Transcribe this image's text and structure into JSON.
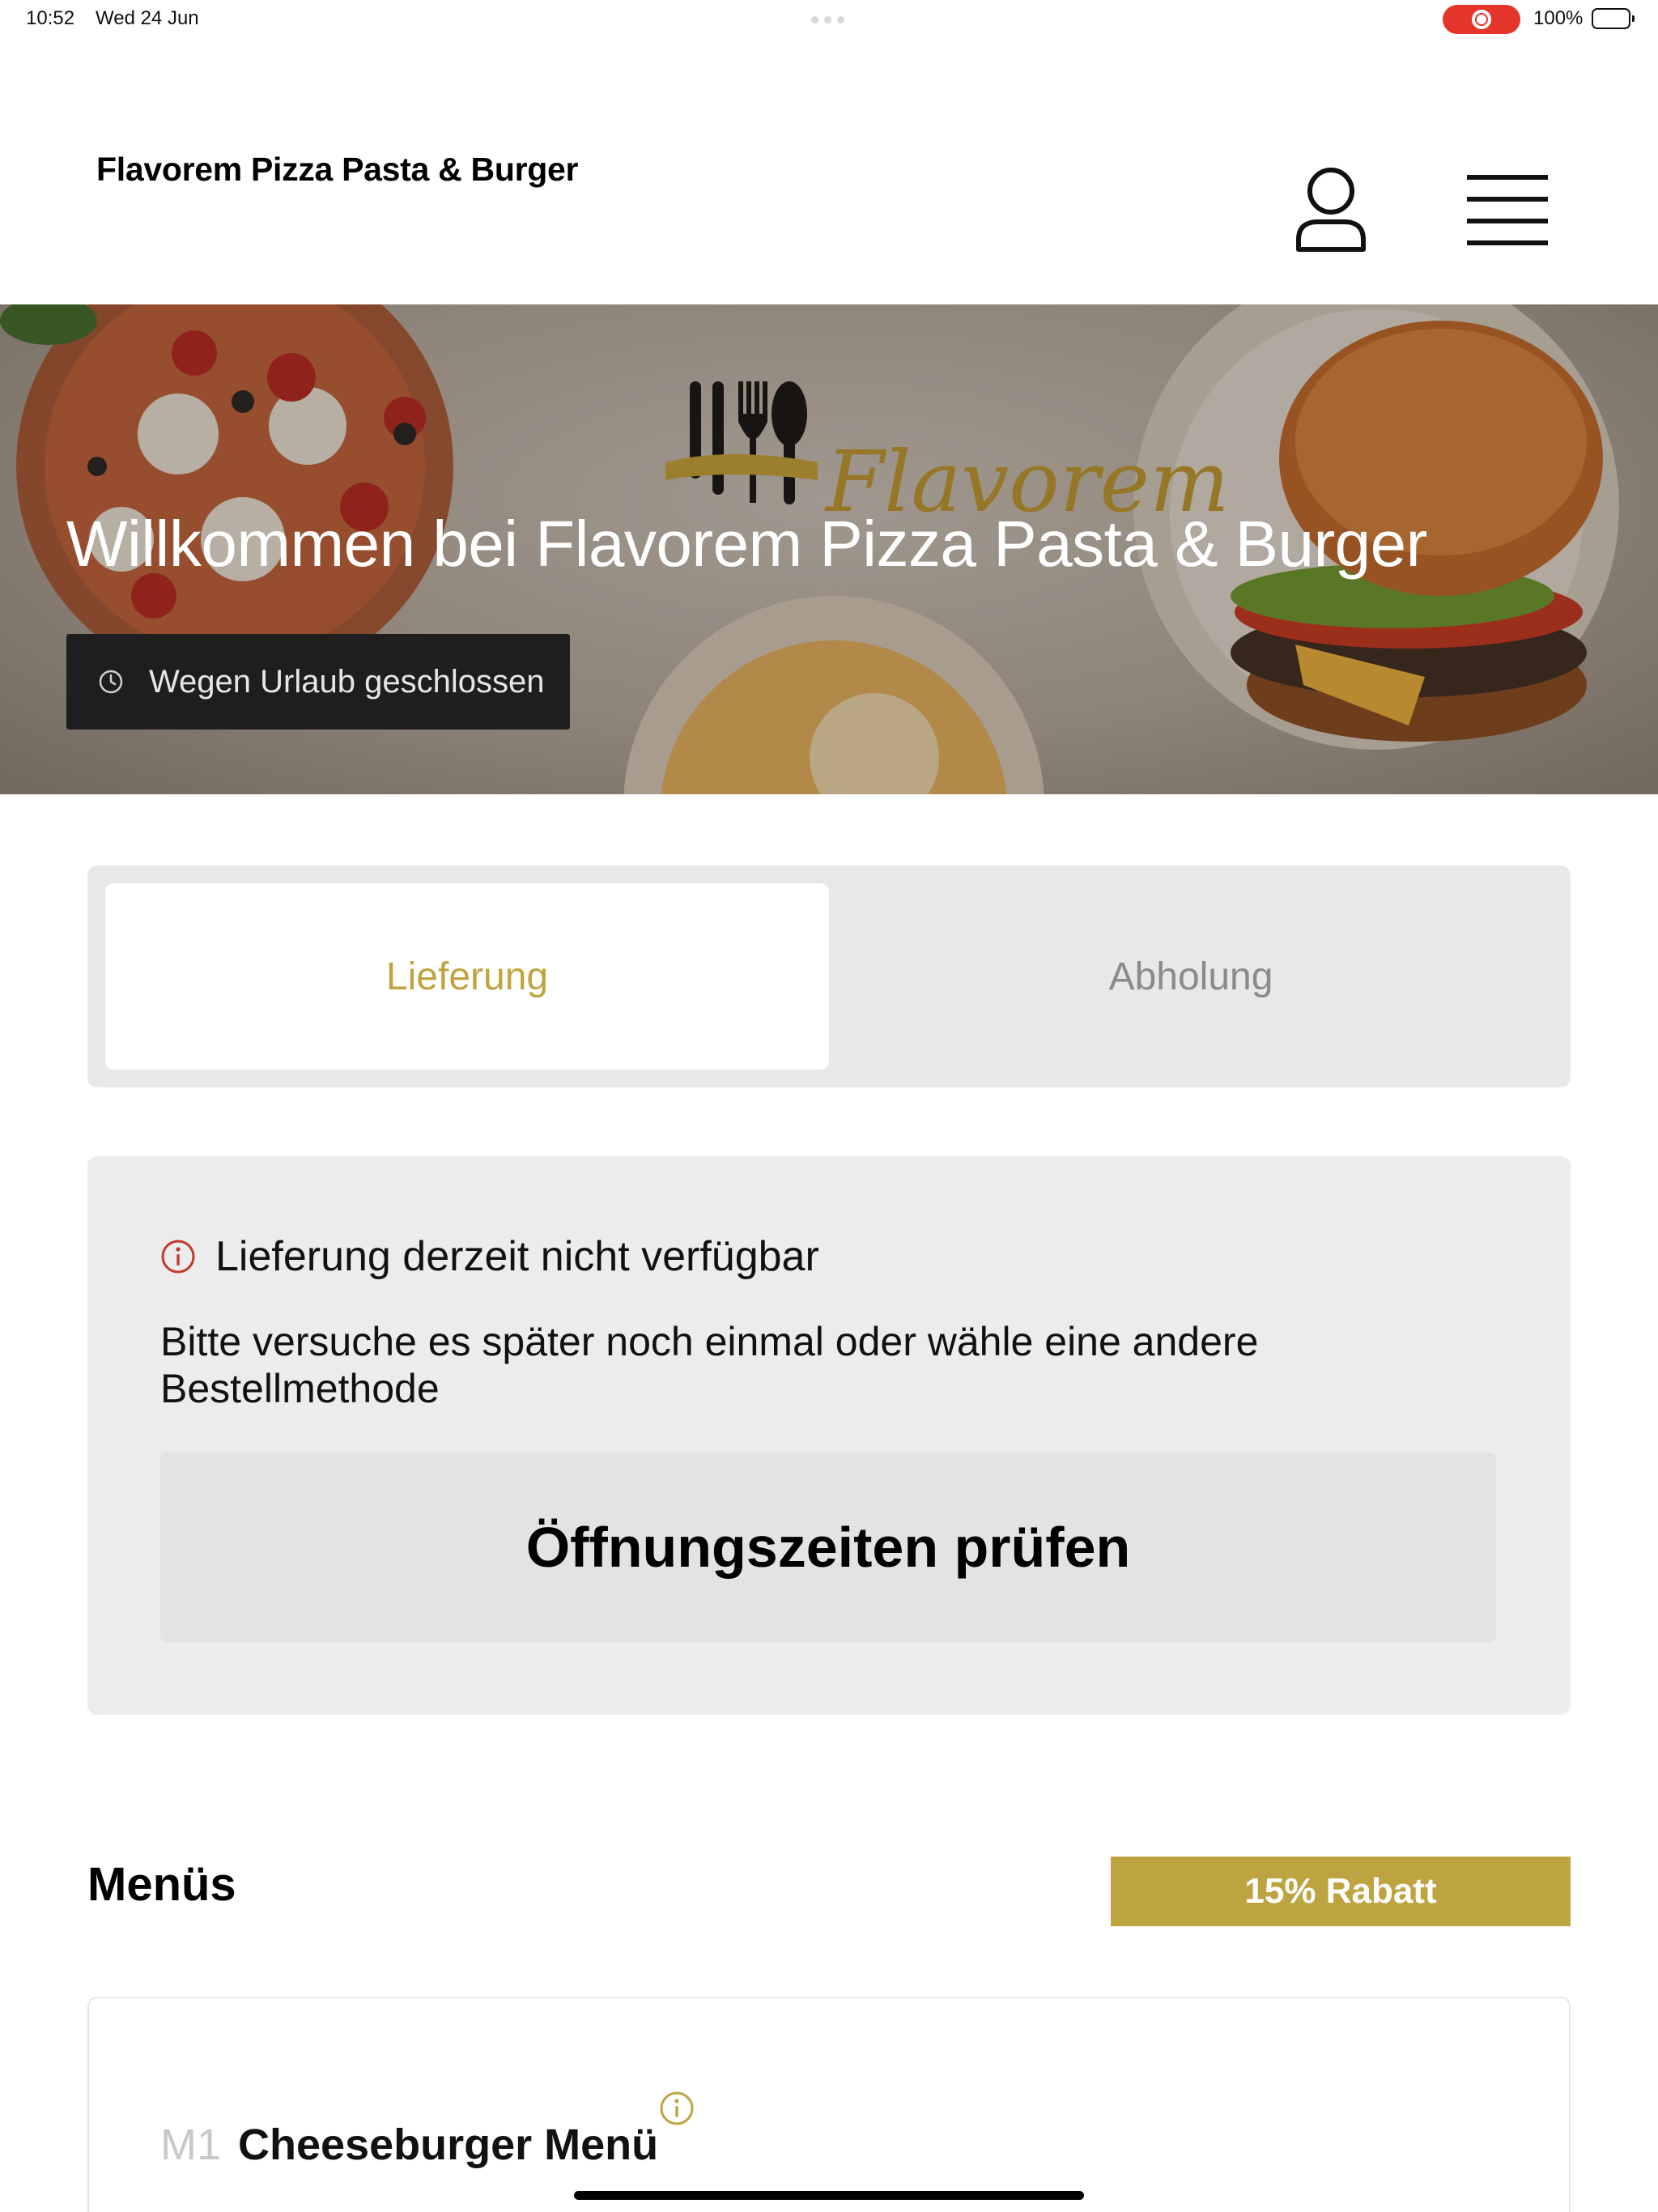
{
  "status_bar": {
    "time": "10:52",
    "date": "Wed 24 Jun",
    "battery": "100%"
  },
  "header": {
    "brand": "Flavorem Pizza Pasta & Burger",
    "user_icon": "user-icon",
    "menu_icon": "hamburger-menu-icon"
  },
  "hero": {
    "title": "Willkommen bei Flavorem Pizza Pasta & Burger",
    "closed_badge": "Wegen Urlaub geschlossen",
    "logo_text": "Flavorem"
  },
  "tabs": {
    "delivery": "Lieferung",
    "pickup": "Abholung",
    "selected": "Lieferung"
  },
  "notice": {
    "title": "Lieferung derzeit nicht verfügbar",
    "body": "Bitte versuche es später noch einmal oder wähle eine andere Bestellmethode",
    "button": "Öffnungszeiten prüfen"
  },
  "menus": {
    "title": "Menüs",
    "discount": "15% Rabatt",
    "items": [
      {
        "code": "M1",
        "name": "Cheeseburger Menü"
      }
    ]
  },
  "colors": {
    "accent": "#bea440",
    "alert": "#c0392b",
    "badge_bg": "#1e1e1e",
    "card_bg": "#ececec"
  }
}
